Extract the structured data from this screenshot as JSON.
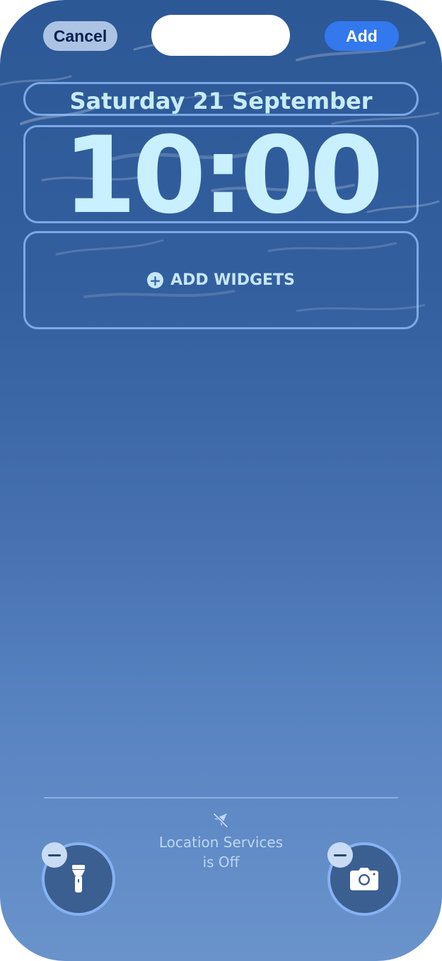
{
  "toolbar": {
    "cancel_label": "Cancel",
    "add_label": "Add"
  },
  "lockscreen": {
    "date": "Saturday 21 September",
    "time": "10:00",
    "widgets_label": "ADD WIDGETS",
    "widgets_plus": "+"
  },
  "location_notice": {
    "line1": "Location Services",
    "line2": "is Off",
    "icon": "location-off-icon"
  },
  "quick_actions": [
    {
      "icon": "flashlight-icon"
    },
    {
      "icon": "camera-icon"
    }
  ],
  "colors": {
    "accent": "#3478ee",
    "wallpaper_top": "#2d5896",
    "wallpaper_bottom": "#6a93cb",
    "frame_outline": "#96c3ff"
  }
}
